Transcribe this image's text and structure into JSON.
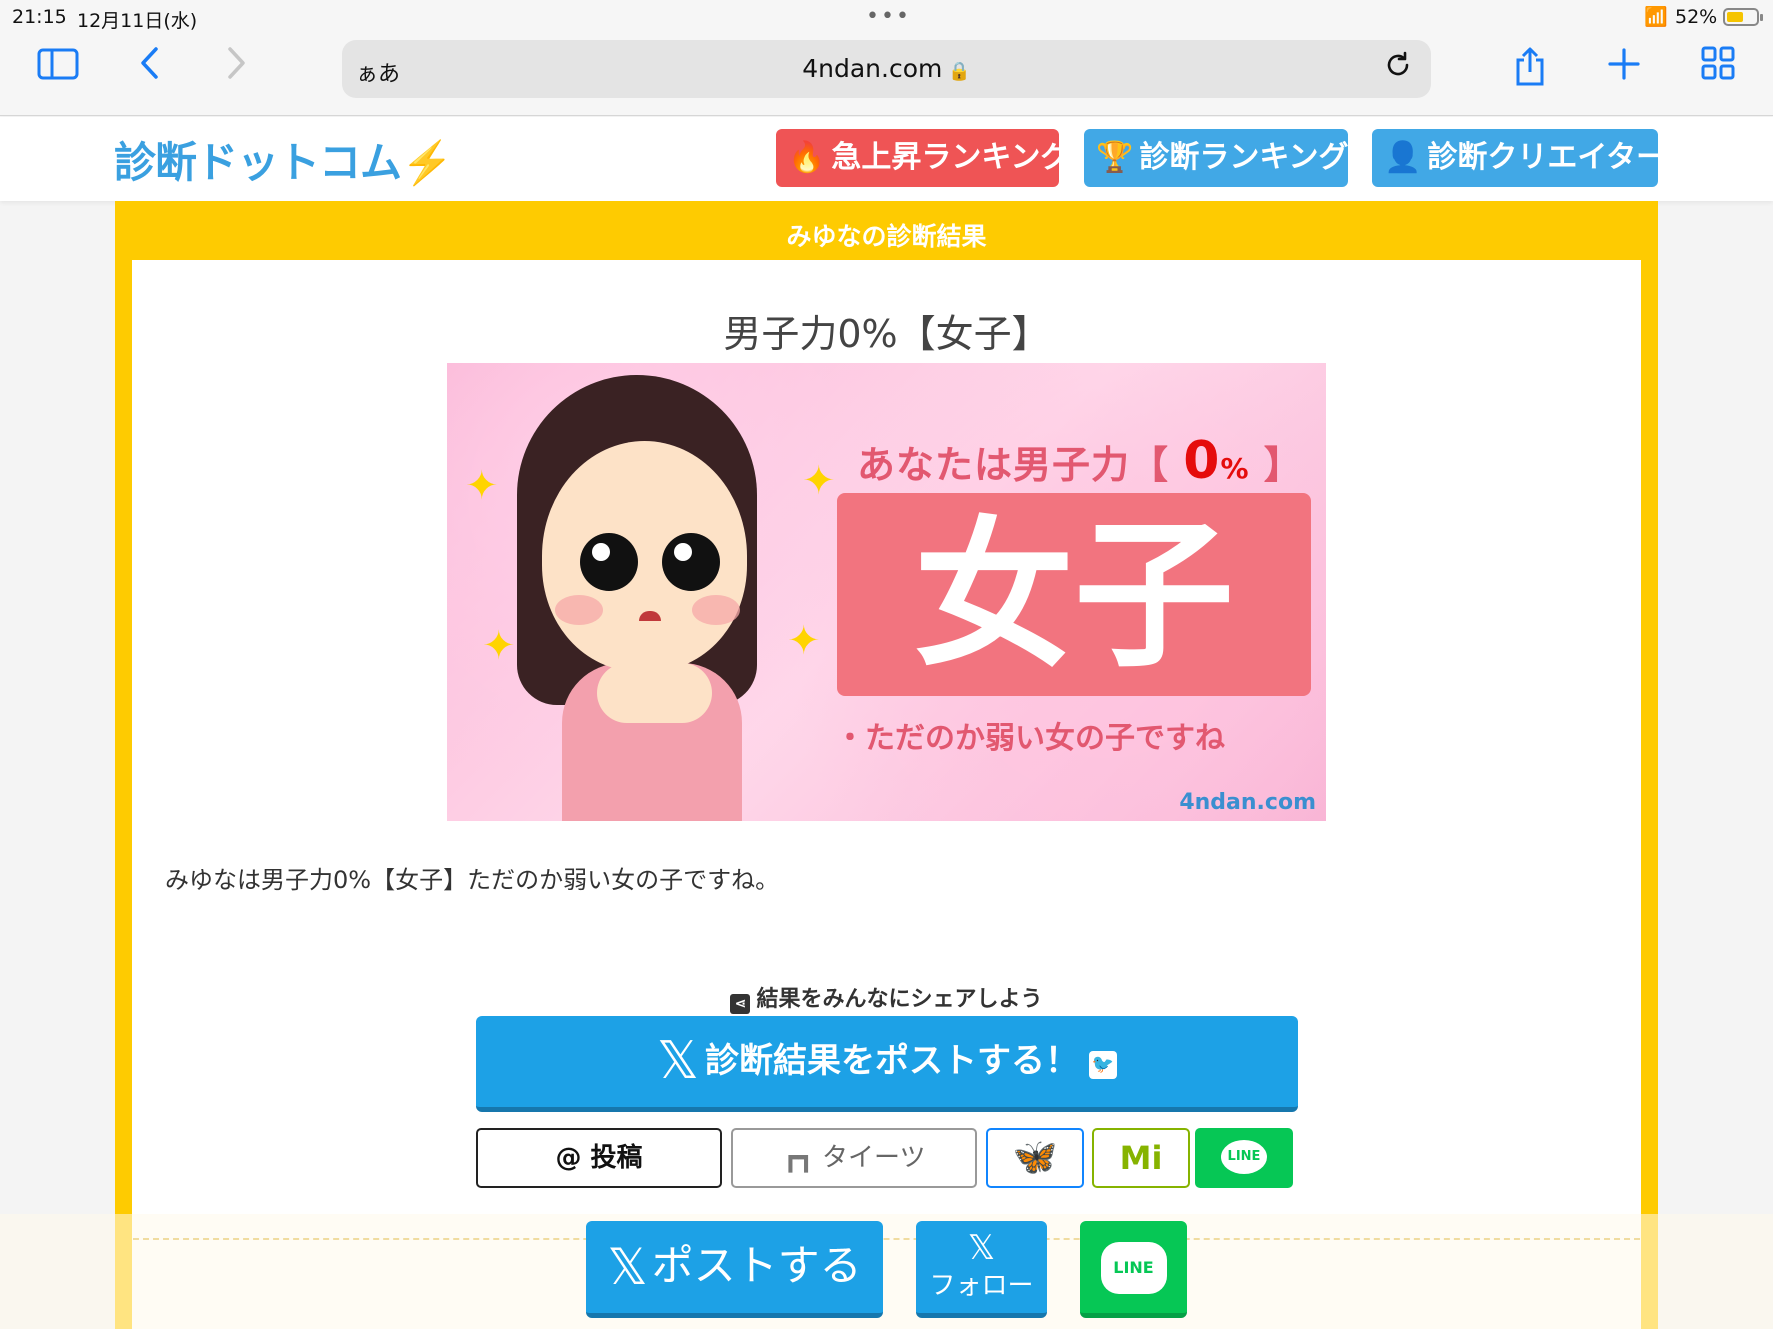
{
  "status_bar": {
    "time": "21:15",
    "date": "12月11日(水)",
    "battery": "52%"
  },
  "browser": {
    "text_size_label": "ぁあ",
    "url": "4ndan.com",
    "icons": {
      "sidebar": "sidebar-icon",
      "back": "back-icon",
      "forward": "forward-icon",
      "reload": "reload-icon",
      "share": "share-icon",
      "new_tab": "plus-icon",
      "tabs": "tabs-overview-icon"
    }
  },
  "site": {
    "logo": "診断ドットコム",
    "nav": {
      "rising": "急上昇ランキング",
      "ranking": "診断ランキング",
      "creator": "診断クリエイター"
    },
    "colors": {
      "frame": "#fecb01",
      "rising": "#ef5455",
      "nav_blue": "#41a8e6",
      "x_blue": "#1da1e6",
      "line_green": "#06c755"
    }
  },
  "result": {
    "frame_title": "みゆなの診断結果",
    "title": "男子力0%【女子】",
    "image": {
      "headline_prefix": "あなたは男子力【",
      "headline_value": "0",
      "headline_unit": "%",
      "headline_suffix": "】",
      "big_word": "女子",
      "subtitle": "・ただのか弱い女の子ですね",
      "watermark": "4ndan.com"
    },
    "text": "みゆなは男子力0%【女子】ただのか弱い女の子ですね。"
  },
  "share": {
    "heading": "結果をみんなにシェアしよう",
    "post_big": "診断結果をポストする！",
    "threads": "投稿",
    "taittsu": "タイーツ",
    "line_label": "LINE"
  },
  "bottom_bar": {
    "post": "ポストする",
    "follow": "フォロー",
    "line_label": "LINE"
  }
}
